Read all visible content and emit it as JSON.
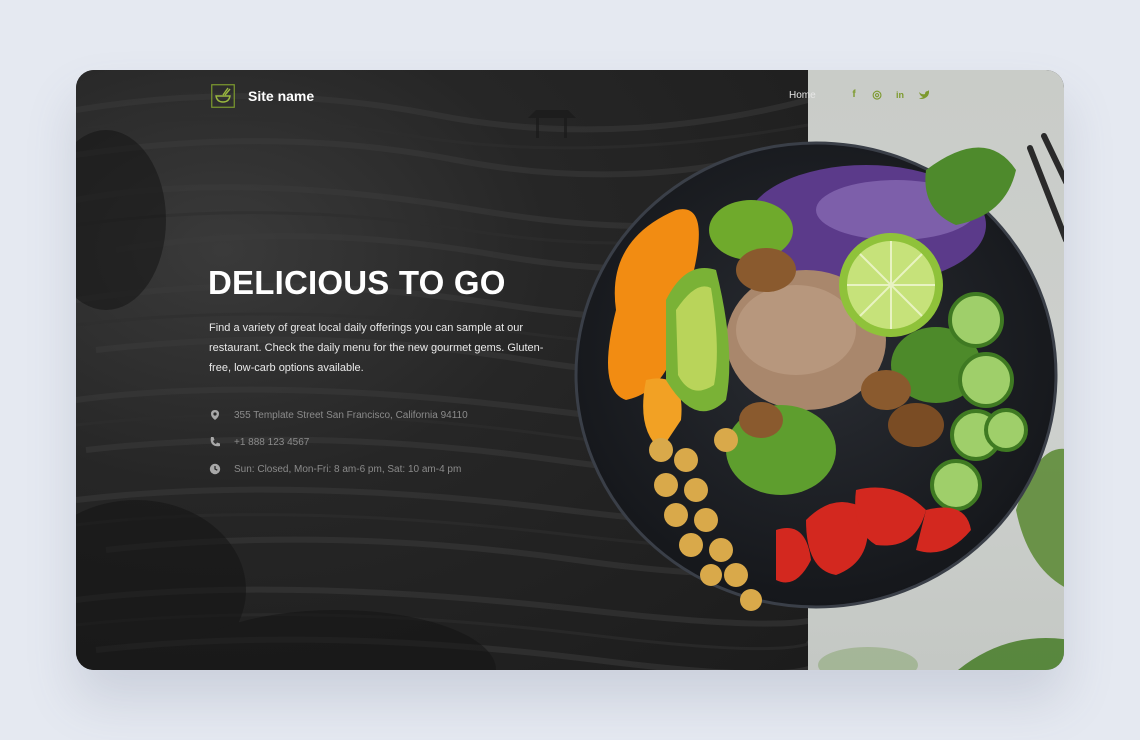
{
  "header": {
    "site_name": "Site name",
    "nav": [
      {
        "label": "Home"
      }
    ],
    "social": [
      {
        "name": "facebook-icon",
        "glyph": "f"
      },
      {
        "name": "instagram-icon",
        "glyph": "◎"
      },
      {
        "name": "linkedin-icon",
        "glyph": "in"
      },
      {
        "name": "twitter-icon",
        "glyph": "❤"
      }
    ]
  },
  "hero": {
    "title": "DELICIOUS TO GO",
    "description": "Find a variety of great local daily offerings you can sample at our restaurant. Check the daily menu for the new gourmet gems. Gluten-free, low-carb options available."
  },
  "contact": {
    "address": "355 Template Street San Francisco, California 94110",
    "phone": "+1 888 123 4567",
    "hours": "Sun: Closed, Mon-Fri: 8 am-6 pm, Sat: 10 am-4 pm"
  },
  "colors": {
    "accent": "#7d9a2e",
    "page_background": "#e5e9f1",
    "dark_panel": "#222222",
    "light_panel": "#cbcecb"
  }
}
